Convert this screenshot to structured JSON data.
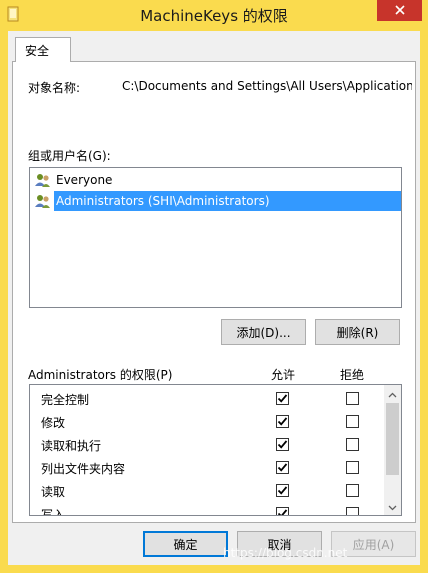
{
  "window": {
    "title": "MachineKeys 的权限"
  },
  "tab": {
    "label": "安全"
  },
  "object": {
    "label": "对象名称:",
    "value": "C:\\Documents and Settings\\All Users\\Application"
  },
  "groups": {
    "label": "组或用户名(G):",
    "items": [
      {
        "name": "Everyone",
        "selected": false,
        "icon": "users-group-icon"
      },
      {
        "name": "Administrators (SHI\\Administrators)",
        "selected": true,
        "icon": "users-group-icon"
      }
    ]
  },
  "buttons": {
    "add": "添加(D)...",
    "remove": "删除(R)"
  },
  "permissions": {
    "header": "Administrators 的权限(P)",
    "allow_label": "允许",
    "deny_label": "拒绝",
    "rows": [
      {
        "name": "完全控制",
        "allow": true,
        "deny": false
      },
      {
        "name": "修改",
        "allow": true,
        "deny": false
      },
      {
        "name": "读取和执行",
        "allow": true,
        "deny": false
      },
      {
        "name": "列出文件夹内容",
        "allow": true,
        "deny": false
      },
      {
        "name": "读取",
        "allow": true,
        "deny": false
      },
      {
        "name": "写入",
        "allow": true,
        "deny": false
      }
    ]
  },
  "footer": {
    "ok": "确定",
    "cancel": "取消",
    "apply": "应用(A)"
  },
  "watermark": "https://blog.csdn.net",
  "colors": {
    "frame": "#fadb4e",
    "selection": "#3399ff",
    "close": "#c7342b",
    "default_border": "#0078d7"
  }
}
